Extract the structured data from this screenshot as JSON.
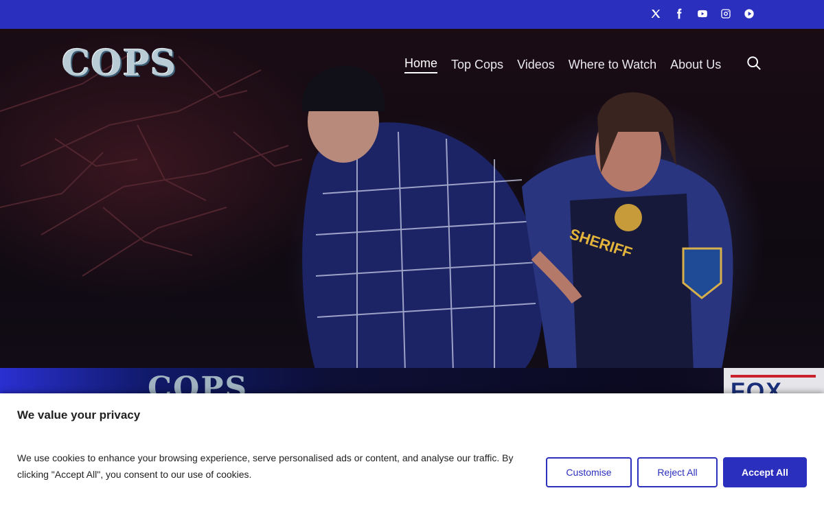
{
  "social": [
    {
      "name": "x-icon"
    },
    {
      "name": "facebook-icon"
    },
    {
      "name": "youtube-icon"
    },
    {
      "name": "instagram-icon"
    },
    {
      "name": "play-circle-icon"
    }
  ],
  "brand": {
    "logo_text": "COPS",
    "banner_logo_text": "COPS",
    "network_text": "FOX"
  },
  "nav": {
    "items": [
      {
        "label": "Home",
        "active": true
      },
      {
        "label": "Top Cops"
      },
      {
        "label": "Videos"
      },
      {
        "label": "Where to Watch"
      },
      {
        "label": "About Us"
      }
    ]
  },
  "hero": {
    "badge_text": "SHERIFF"
  },
  "cookie": {
    "title": "We value your privacy",
    "body": "We use cookies to enhance your browsing experience, serve personalised ads or content, and analyse our traffic. By clicking \"Accept All\", you consent to our use of cookies.",
    "customise_label": "Customise",
    "reject_label": "Reject All",
    "accept_label": "Accept All"
  },
  "colors": {
    "accent": "#2b2fbd",
    "text": "#212121"
  }
}
